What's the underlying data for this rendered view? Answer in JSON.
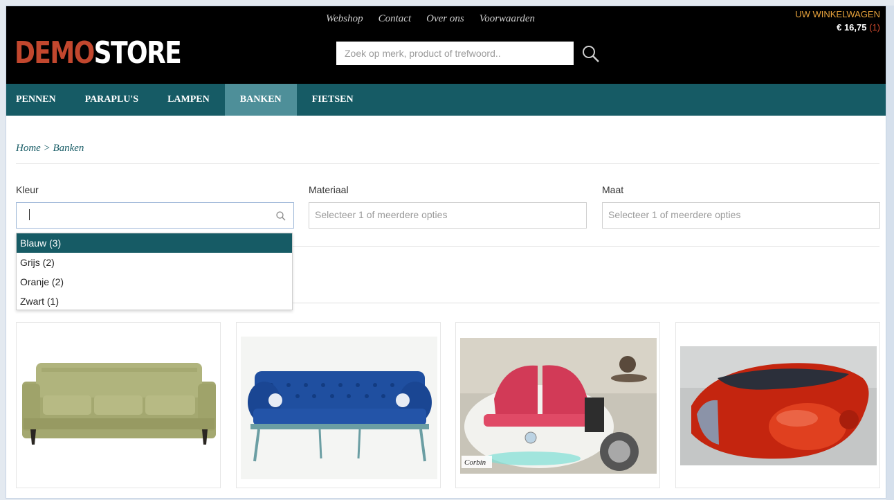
{
  "store": {
    "logo_part1": "DEMO",
    "logo_part2": "STORE"
  },
  "topnav": [
    "Webshop",
    "Contact",
    "Over ons",
    "Voorwaarden"
  ],
  "search": {
    "placeholder": "Zoek op merk, product of trefwoord.."
  },
  "cart": {
    "title": "UW WINKELWAGEN",
    "total": "€ 16,75",
    "count": "(1)"
  },
  "mainnav": [
    {
      "label": "PENNEN",
      "active": false
    },
    {
      "label": "PARAPLU'S",
      "active": false
    },
    {
      "label": "LAMPEN",
      "active": false
    },
    {
      "label": "BANKEN",
      "active": true
    },
    {
      "label": "FIETSEN",
      "active": false
    }
  ],
  "breadcrumb": "Home > Banken",
  "filters": {
    "kleur": {
      "label": "Kleur",
      "value": ""
    },
    "materiaal": {
      "label": "Materiaal",
      "placeholder": "Selecteer 1 of meerdere opties"
    },
    "maat": {
      "label": "Maat",
      "placeholder": "Selecteer 1 of meerdere opties"
    }
  },
  "kleur_options": [
    "Blauw (3)",
    "Grijs (2)",
    "Oranje (2)",
    "Zwart (1)"
  ],
  "products": [
    {
      "name": "green-sofa"
    },
    {
      "name": "blue-chesterfield-sofa"
    },
    {
      "name": "car-sofa",
      "brand_label": "Corbin"
    },
    {
      "name": "red-pod-sofa"
    }
  ],
  "colors": {
    "header": "#000000",
    "nav": "#165b65",
    "nav_active": "#4e8f99",
    "logo_accent": "#c2472e",
    "cart_title": "#e8a33c"
  }
}
